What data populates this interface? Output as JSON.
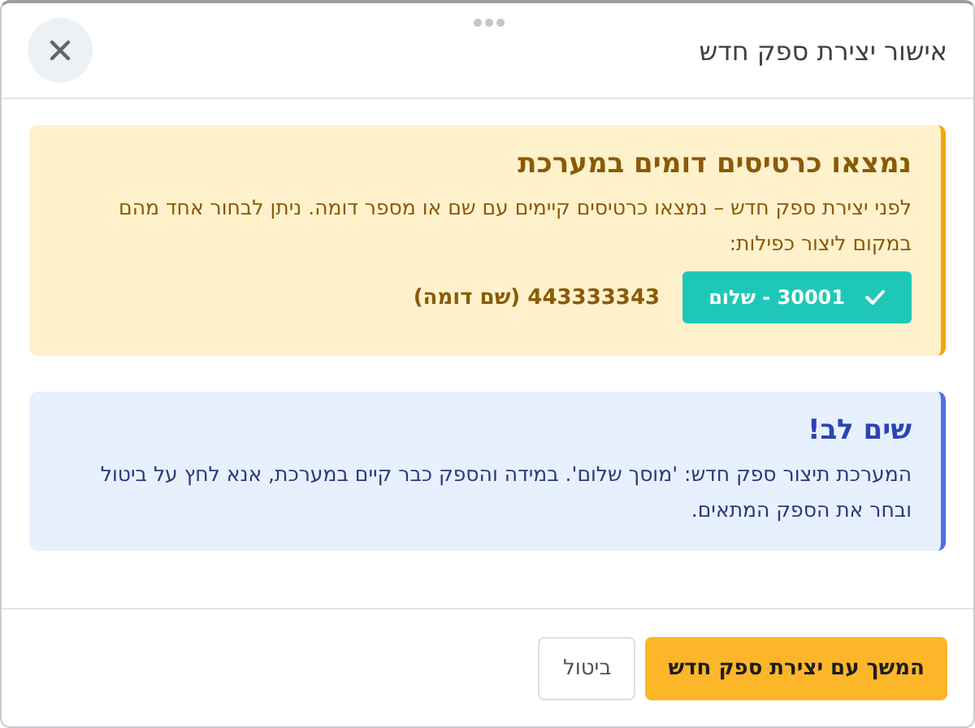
{
  "dialog": {
    "title": "אישור יצירת ספק חדש"
  },
  "warning": {
    "title": "נמצאו כרטיסים דומים במערכת",
    "text": "לפני יצירת ספק חדש – נמצאו כרטיסים קיימים עם שם או מספר דומה. ניתן לבחור אחד מהם במקום ליצור כפילות:",
    "matches": [
      {
        "label": "30001 - שלום",
        "selected": true,
        "detail": "443333343 (שם דומה)"
      }
    ]
  },
  "notice": {
    "title": "שים לב!",
    "text": "המערכת תיצור ספק חדש: 'מוסך שלום'. במידה והספק כבר קיים במערכת, אנא לחץ על ביטול ובחר את הספק המתאים."
  },
  "buttons": [
    {
      "label": "המשך עם יצירת ספק חדש",
      "kind": "primary"
    },
    {
      "label": "ביטול",
      "kind": "secondary"
    }
  ]
}
